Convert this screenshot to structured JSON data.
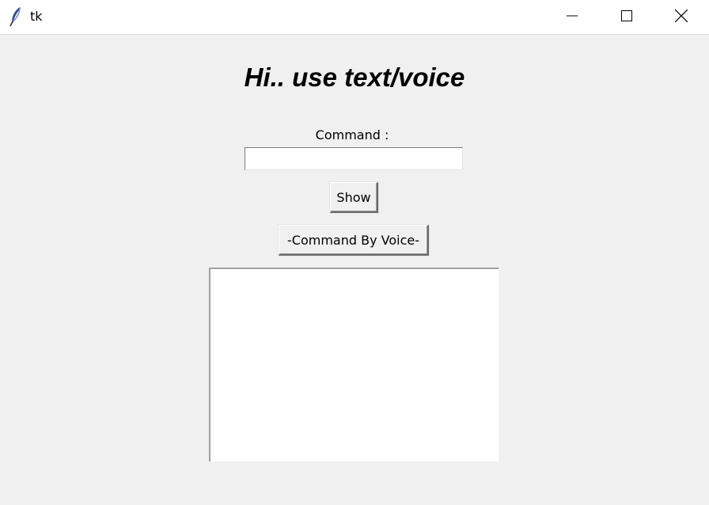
{
  "window": {
    "title": "tk"
  },
  "main": {
    "heading": "Hi.. use text/voice",
    "command_label": "Command :",
    "command_value": "",
    "show_button": "Show",
    "voice_button": "-Command By Voice-",
    "output_text": ""
  },
  "icons": {
    "app": "tk-feather-icon",
    "minimize": "minimize-icon",
    "maximize": "maximize-icon",
    "close": "close-icon"
  },
  "colors": {
    "window_bg": "#f0f0f0",
    "titlebar_bg": "#ffffff"
  }
}
